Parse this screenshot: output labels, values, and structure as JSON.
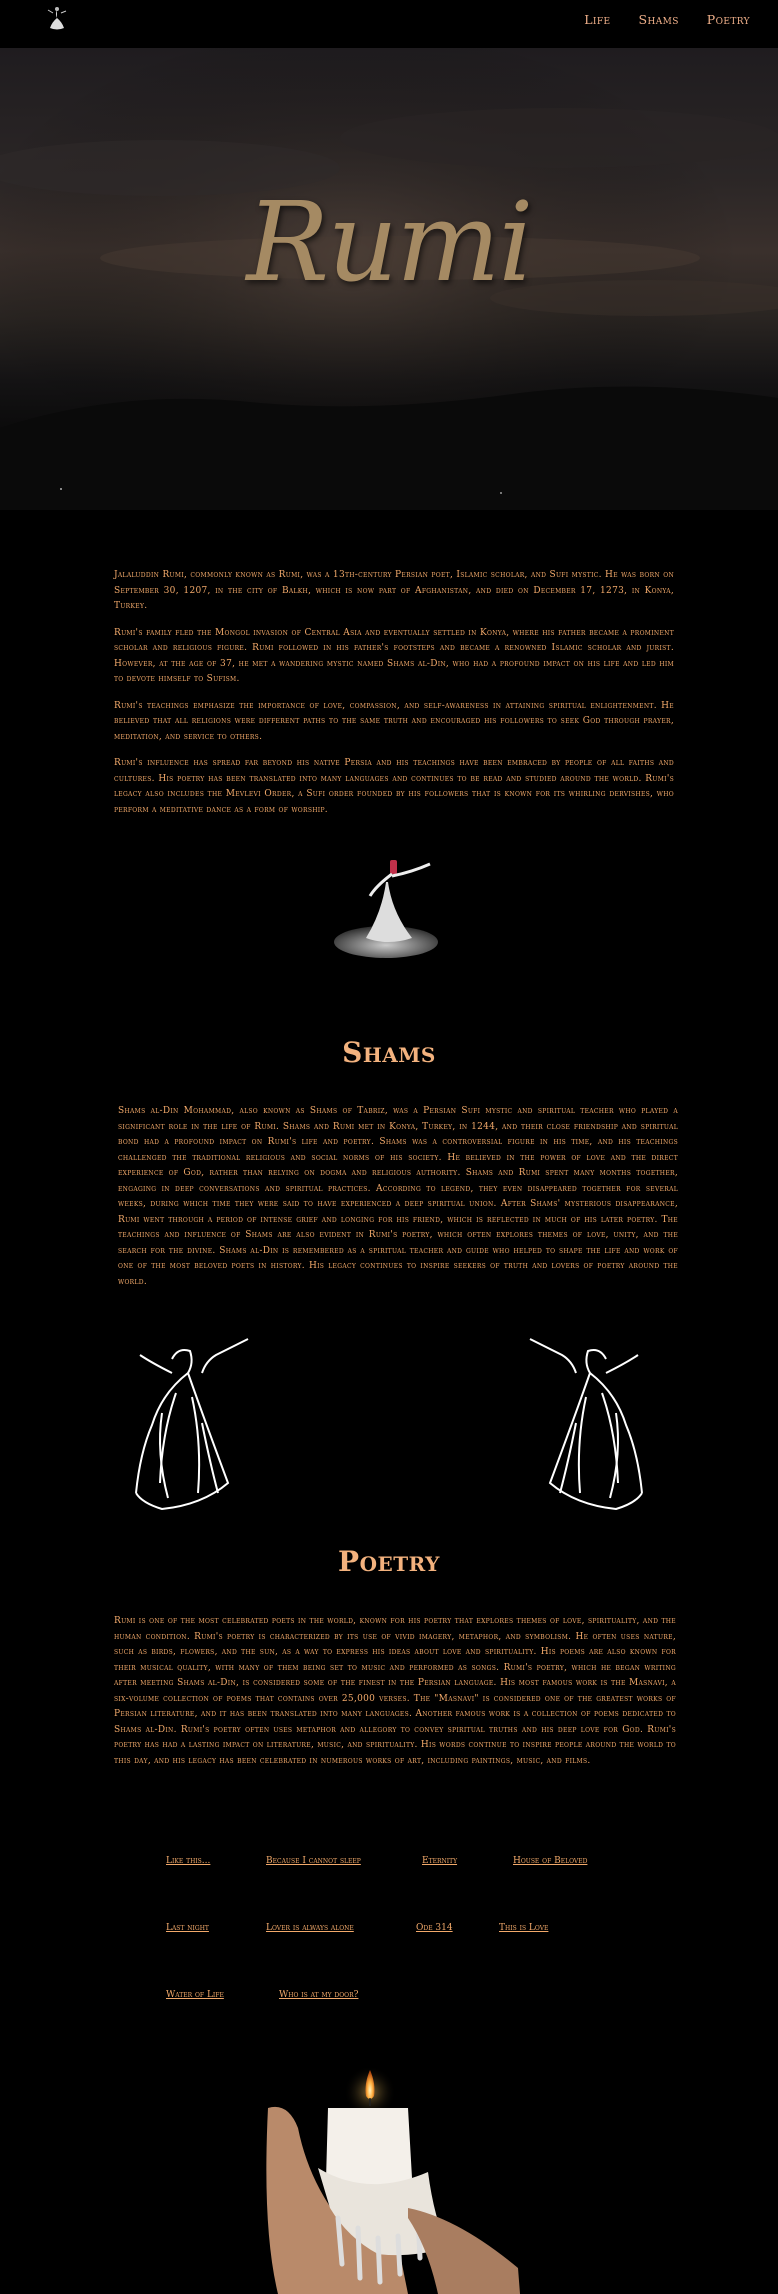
{
  "nav": {
    "logo_alt": "whirling dervish logo",
    "links": [
      "Life",
      "Shams",
      "Poetry"
    ]
  },
  "hero": {
    "title": "Rumi"
  },
  "life": {
    "paragraphs": [
      "Jalaluddin Rumi, commonly known as Rumi, was a 13th-century Persian poet, Islamic scholar, and Sufi mystic. He was born on September 30, 1207, in the city of Balkh, which is now part of Afghanistan, and died on December 17, 1273, in Konya, Turkey.",
      "Rumi's family fled the Mongol invasion of Central Asia and eventually settled in Konya, where his father became a prominent scholar and religious figure. Rumi followed in his father's footsteps and became a renowned Islamic scholar and jurist. However, at the age of 37, he met a wandering mystic named Shams al-Din, who had a profound impact on his life and led him to devote himself to Sufism.",
      "Rumi's teachings emphasize the importance of love, compassion, and self-awareness in attaining spiritual enlightenment. He believed that all religions were different paths to the same truth and encouraged his followers to seek God through prayer, meditation, and service to others.",
      "Rumi's influence has spread far beyond his native Persia and his teachings have been embraced by people of all faiths and cultures. His poetry has been translated into many languages and continues to be read and studied around the world. Rumi's legacy also includes the Mevlevi Order, a Sufi order founded by his followers that is known for its whirling dervishes, who perform a meditative dance as a form of worship."
    ]
  },
  "shams": {
    "title": "Shams",
    "text": "Shams al-Din Mohammad, also known as Shams of Tabriz, was a Persian Sufi mystic and spiritual teacher who played a significant role in the life of Rumi. Shams and Rumi met in Konya, Turkey, in 1244, and their close friendship and spiritual bond had a profound impact on Rumi's life and poetry. Shams was a controversial figure in his time, and his teachings challenged the traditional religious and social norms of his society. He believed in the power of love and the direct experience of God, rather than relying on dogma and religious authority. Shams and Rumi spent many months together, engaging in deep conversations and spiritual practices. According to legend, they even disappeared together for several weeks, during which time they were said to have experienced a deep spiritual union. After Shams' mysterious disappearance, Rumi went through a period of intense grief and longing for his friend, which is reflected in much of his later poetry. The teachings and influence of Shams are also evident in Rumi's poetry, which often explores themes of love, unity, and the search for the divine. Shams al-Din is remembered as a spiritual teacher and guide who helped to shape the life and work of one of the most beloved poets in history. His legacy continues to inspire seekers of truth and lovers of poetry around the world."
  },
  "poetry": {
    "title": "Poetry",
    "text": "Rumi is one of the most celebrated poets in the world, known for his poetry that explores themes of love, spirituality, and the human condition. Rumi's poetry is characterized by its use of vivid imagery, metaphor, and symbolism. He often uses nature, such as birds, flowers, and the sun, as a way to express his ideas about love and spirituality. His poems are also known for their musical quality, with many of them being set to music and performed as songs. Rumi's poetry, which he began writing after meeting Shams al-Din, is considered some of the finest in the Persian language. His most famous work is the Masnavi, a six-volume collection of poems that contains over 25,000 verses. The \"Masnavi\" is considered one of the greatest works of Persian literature, and it has been translated into many languages. Another famous work is a collection of poems dedicated to Shams al-Din. Rumi's poetry often uses metaphor and allegory to convey spiritual truths and his deep love for God. Rumi's poetry has had a lasting impact on literature, music, and spirituality. His words continue to inspire people around the world to this day, and his legacy has been celebrated in numerous works of art, including paintings, music, and films.",
    "poems": [
      [
        "Like this...",
        "Because I cannot sleep",
        "Eternity",
        "House of Beloved"
      ],
      [
        "Last night",
        "Lover is always alone",
        "Ode 314",
        "This is Love"
      ],
      [
        "Water of Life",
        "Who is at my door?"
      ]
    ]
  }
}
